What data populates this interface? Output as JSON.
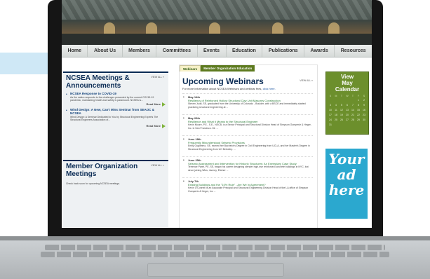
{
  "nav": {
    "items": [
      "Home",
      "About Us",
      "Members",
      "Committees",
      "Events",
      "Education",
      "Publications",
      "Awards",
      "Resources"
    ]
  },
  "meetings_box": {
    "title": "NCSEA Meetings & Announcements",
    "view_all": "VIEW ALL »",
    "items": [
      {
        "title": "NCSEA Response to COVID-19",
        "body": "As the nation responds to the challenges presented by the current COVID-19 pandemic, maintaining health and safety is paramount. NCSEA is..."
      },
      {
        "title": "Wind Design: A New, Can't Miss Seminar from SEAOC & NCSEA",
        "body": "Wind Design: A Seminar Dedicated to You by Structural Engineering Experts  The Structural Engineers Association of..."
      }
    ],
    "read_more": "Read More"
  },
  "member_box": {
    "title": "Member Organization Meetings",
    "view_all": "VIEW ALL »",
    "note": "Check back soon for upcoming NCSEA meetings."
  },
  "tabs": {
    "active": "Webinars",
    "other": "Member Organization Education"
  },
  "webinars": {
    "title": "Upcoming Webinars",
    "view_all": "VIEW ALL »",
    "subtitle": "For more information about NCSEA Webinars and webinar fees,",
    "subtitle_link": "click here.",
    "events": [
      {
        "date": "May 14th",
        "title": "Resiliency of Reinforced Hollow Structural Clay Unit Masonry Construction",
        "desc": "Steven Judd, SE, graduated from the University of Colorado - Boulder, with a BSCE and immediately started practicing structural engineering at ..."
      },
      {
        "date": "May 26th",
        "title": "Resilience and What it Means to the Structural Engineer",
        "desc": "Kevin Moore, P.E., S.E., NECB, is a Senior Principal and Structural Division Head of Simpson Gumpertz & Heger, Inc. in San Francisco. Mr. ..."
      },
      {
        "date": "June 18th",
        "title": "Frequently Misunderstood Seismic Provisions",
        "desc": "Emily Guglielmo, SE, earned her Bachelor's Degree in Civil Engineering from UCLA, and her Master's Degree in Structural Engineering from UC Berkeley. ..."
      },
      {
        "date": "June 25th",
        "title": "Seismic Assessment and Intervention for Historic Structures: An Exemplary Case Study",
        "desc": "Terrence Paret, PE, SE, began his career designing slender high-rise reinforced concrete buildings in NYC, but since joining Wiss, Janney, Elstner ..."
      },
      {
        "date": "July 7th",
        "title": "Existing Buildings and the \"10% Rule\" - Are We in Agreement?",
        "desc": "Kevin O'Connell is an Associate Principal and Structural Engineering Division Head of the LA office of Simpson Gumpertz & Heger, Inc ..."
      }
    ]
  },
  "calendar": {
    "label_line1": "View",
    "label_line2": "May",
    "label_line3": "Calendar",
    "weekdays": [
      "S",
      "M",
      "T",
      "W",
      "T",
      "F",
      "S"
    ],
    "dates": [
      "",
      "",
      "",
      "",
      "",
      "1",
      "2",
      "3",
      "4",
      "5",
      "6",
      "7",
      "8",
      "9",
      "10",
      "11",
      "12",
      "13",
      "14",
      "15",
      "16",
      "17",
      "18",
      "19",
      "20",
      "21",
      "22",
      "23",
      "24",
      "25",
      "26",
      "27",
      "28",
      "29",
      "30",
      "31",
      "",
      "",
      "",
      "",
      "",
      ""
    ]
  },
  "ad": {
    "line1": "Your",
    "line2": "ad",
    "line3": "here"
  },
  "colors": {
    "navy": "#0b2c55",
    "green": "#6c8f2c",
    "ad_blue": "#2ba8cf"
  }
}
